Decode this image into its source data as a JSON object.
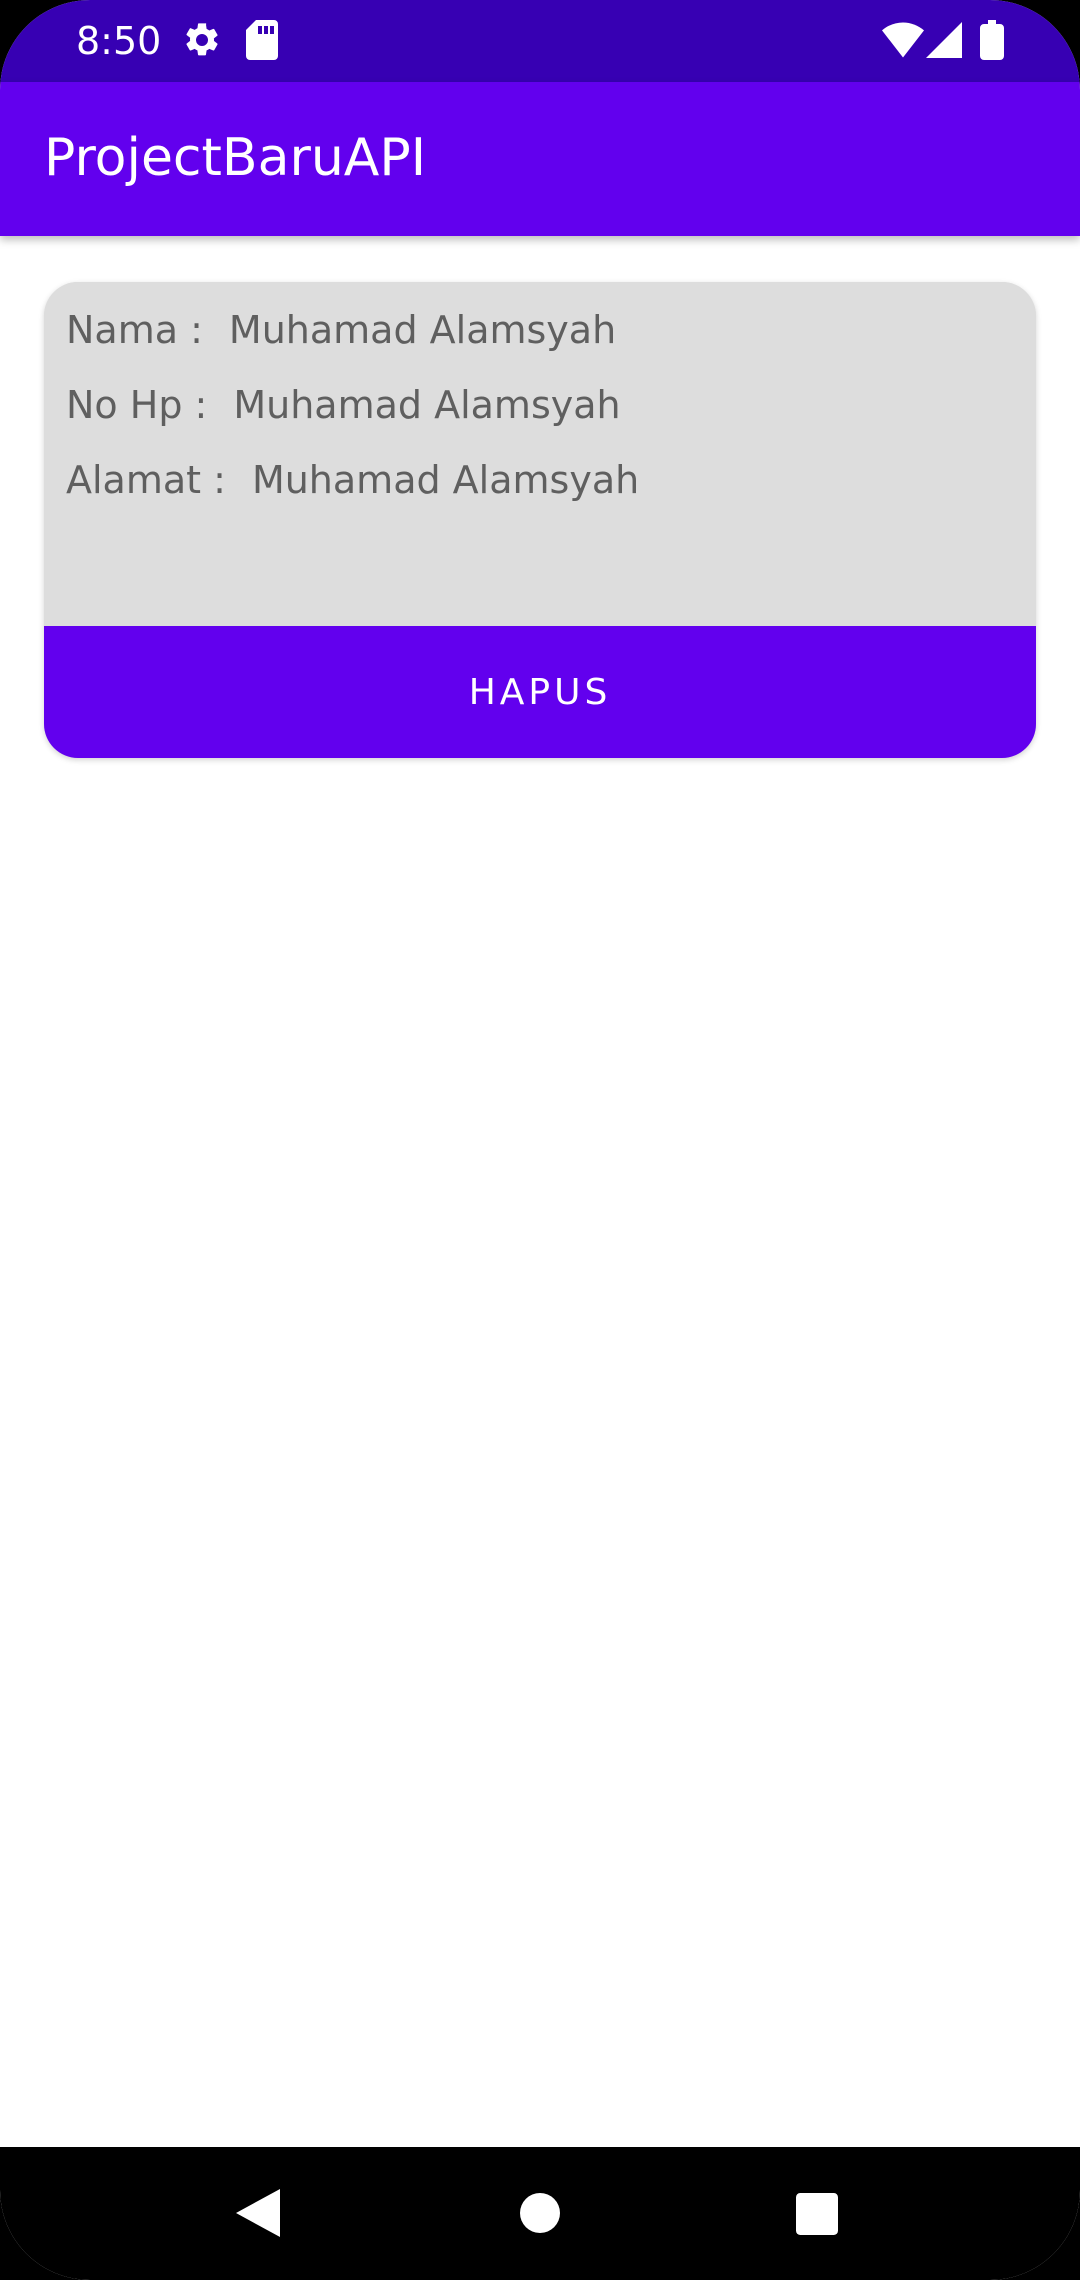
{
  "status_bar": {
    "time": "8:50",
    "icons": [
      "gear-icon",
      "sd-card-icon",
      "wifi-icon",
      "cell-signal-icon",
      "battery-icon"
    ]
  },
  "app_bar": {
    "title": "ProjectBaruAPI"
  },
  "card": {
    "rows": [
      {
        "label": "Nama :",
        "value": "Muhamad Alamsyah"
      },
      {
        "label": "No Hp :",
        "value": "Muhamad Alamsyah"
      },
      {
        "label": "Alamat :",
        "value": "Muhamad Alamsyah"
      }
    ],
    "delete_label": "HAPUS"
  },
  "nav_bar": {
    "icons": [
      "back-icon",
      "home-icon",
      "recents-icon"
    ]
  },
  "colors": {
    "status_bar": "#3700B3",
    "primary": "#6200EE",
    "card_background": "#DDDDDD",
    "text_secondary": "#5F5F5F"
  }
}
